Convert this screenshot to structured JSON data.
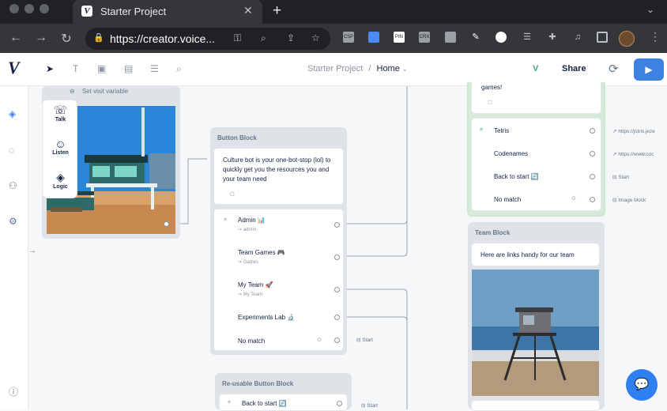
{
  "browser": {
    "tab_title": "Starter Project",
    "url": "https://creator.voice...",
    "extensions": [
      "CSP",
      "PIN",
      "",
      "CRX"
    ]
  },
  "app": {
    "breadcrumb_project": "Starter Project",
    "breadcrumb_sep": "/",
    "breadcrumb_home": "Home",
    "version_badge": "V",
    "share_label": "Share"
  },
  "steps": {
    "talk": "Talk",
    "listen": "Listen",
    "logic": "Logic"
  },
  "left_block": {
    "set_visit": "Set visit variable"
  },
  "button_block": {
    "title": "Button Block",
    "message": "Culture bot is your one-bot-stop (lol) to quickly get you the resources you and your team need",
    "buttons": [
      {
        "label": "Admin 📊",
        "intent": "admin"
      },
      {
        "label": "Team Games 🎮",
        "intent": "Games"
      },
      {
        "label": "My Team 🚀",
        "intent": "My Team"
      },
      {
        "label": "Experiments Lab 🔬",
        "intent": ""
      }
    ],
    "no_match": "No match",
    "no_match_target": "Start"
  },
  "reusable_block": {
    "title": "Re-usable Button Block",
    "button": "Back to start 🔄",
    "target": "Start"
  },
  "games_block": {
    "tail_text": "games!",
    "rows": [
      {
        "label": "Tetris",
        "target": "https://jstris.jeze"
      },
      {
        "label": "Codenames",
        "target": "https://www.coc"
      },
      {
        "label": "Back to start 🔄",
        "target": "Start"
      },
      {
        "label": "No match",
        "target": "Image block"
      }
    ]
  },
  "team_block": {
    "title": "Team Block",
    "message": "Here are links handy for our team"
  }
}
